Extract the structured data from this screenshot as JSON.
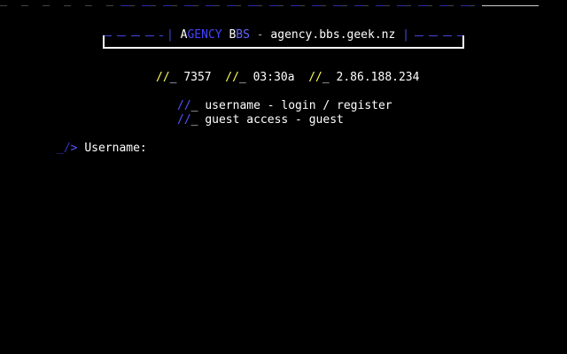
{
  "colors": {
    "background": "#000000",
    "text": "#ffffff",
    "accent_blue": "#4444ff",
    "accent_yellow": "#ffff55"
  },
  "banner": {
    "title_first_letter": "A",
    "title_rest_1": "GENCY",
    "title_b": "B",
    "title_rest_2": "BS",
    "separator": "-",
    "host": "agency.bbs.geek.nz"
  },
  "status": {
    "marker": "//_",
    "node_count": "7357",
    "time": "03:30a",
    "ip": "2.86.188.234"
  },
  "menu": {
    "marker": "//_",
    "items": [
      {
        "label": "username - login / register"
      },
      {
        "label": "guest access - guest"
      }
    ]
  },
  "prompt": {
    "marker_slashes": "_/",
    "marker_accent": ">",
    "label": "Username:",
    "value": ""
  }
}
